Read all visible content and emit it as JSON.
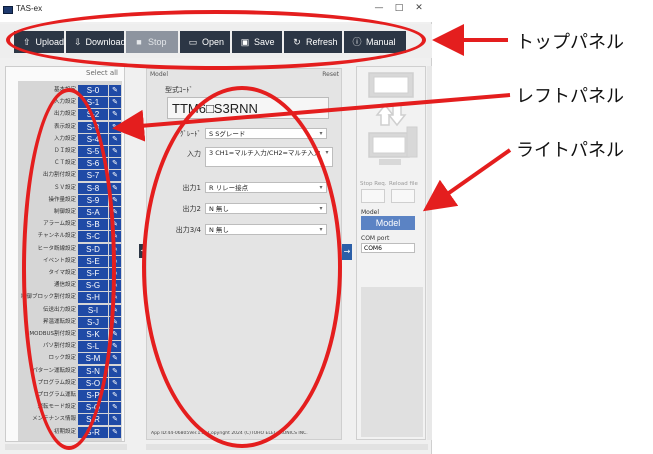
{
  "window": {
    "title": "TAS-ex",
    "controls": [
      "—",
      "□",
      "✕"
    ]
  },
  "toolbar": {
    "buttons": [
      {
        "label": "Upload",
        "icon": "upload-icon",
        "glyph": "⇧",
        "enabled": true
      },
      {
        "label": "Download",
        "icon": "download-icon",
        "glyph": "⇩",
        "enabled": true
      },
      {
        "label": "Stop",
        "icon": "stop-icon",
        "glyph": "■",
        "enabled": false
      },
      {
        "label": "Open",
        "icon": "folder-icon",
        "glyph": "▭",
        "enabled": true
      },
      {
        "label": "Save",
        "icon": "save-icon",
        "glyph": "▣",
        "enabled": true
      },
      {
        "label": "Refresh",
        "icon": "refresh-icon",
        "glyph": "↻",
        "enabled": true
      },
      {
        "label": "Manual",
        "icon": "info-icon",
        "glyph": "ⓘ",
        "enabled": true
      }
    ]
  },
  "left_panel": {
    "header": "Select all",
    "items": [
      {
        "label": "基本設定",
        "code": "S-0"
      },
      {
        "label": "入力設定",
        "code": "S-1"
      },
      {
        "label": "出力設定",
        "code": "S-2"
      },
      {
        "label": "表示設定",
        "code": "S-3"
      },
      {
        "label": "入力設定",
        "code": "S-4"
      },
      {
        "label": "ＤＩ設定",
        "code": "S-5"
      },
      {
        "label": "ＣＴ設定",
        "code": "S-6"
      },
      {
        "label": "出力割付設定",
        "code": "S-7"
      },
      {
        "label": "ＳＶ設定",
        "code": "S-8"
      },
      {
        "label": "操作量設定",
        "code": "S-9"
      },
      {
        "label": "制御設定",
        "code": "S-A"
      },
      {
        "label": "アラーム設定",
        "code": "S-B"
      },
      {
        "label": "チャンネル設定",
        "code": "S-C"
      },
      {
        "label": "ヒータ断線設定",
        "code": "S-D"
      },
      {
        "label": "イベント設定",
        "code": "S-E"
      },
      {
        "label": "タイマ設定",
        "code": "S-F"
      },
      {
        "label": "通信設定",
        "code": "S-G"
      },
      {
        "label": "制御ブロック割付設定",
        "code": "S-H"
      },
      {
        "label": "伝送出力設定",
        "code": "S-I"
      },
      {
        "label": "昇温運転設定",
        "code": "S-J"
      },
      {
        "label": "MODBUS割付設定",
        "code": "S-K"
      },
      {
        "label": "パソ割付設定",
        "code": "S-L"
      },
      {
        "label": "ロック設定",
        "code": "S-M"
      },
      {
        "label": "パターン運転設定",
        "code": "S-N"
      },
      {
        "label": "プログラム設定",
        "code": "S-O"
      },
      {
        "label": "プログラム運転",
        "code": "S-P"
      },
      {
        "label": "運転モード設定",
        "code": "S-Q"
      },
      {
        "label": "メンテナンス情報",
        "code": "S-R"
      },
      {
        "label": "初期設定",
        "code": "S-R"
      }
    ]
  },
  "center_panel": {
    "label": "Model",
    "right_label": "Reset",
    "model_caption": "型式ｺｰﾄﾞ",
    "model_code": "TTM6□S3RNN",
    "fields": [
      {
        "label": "ｸﾞﾚｰﾄﾞ",
        "value": "S  Sグレード"
      },
      {
        "label": "入力",
        "value": "3  CH1=マルチ入力/CH2=マルチ入力"
      },
      {
        "label": "出力1",
        "value": "R  リレー接点"
      },
      {
        "label": "出力2",
        "value": "N  無し"
      },
      {
        "label": "出力3/4",
        "value": "N  無し"
      }
    ],
    "status": "App ID:44-06805Ver.1.2) Copyright 2024 (C)TOHO ELECTRONICS INC."
  },
  "right_panel": {
    "stop_req": "Stop Req.",
    "reload_file": "Reload file",
    "model_label": "Model",
    "model_button": "Model",
    "com_label": "COM port",
    "com_value": "COM6"
  },
  "annotations": {
    "top_panel": "トップパネル",
    "left_panel": "レフトパネル",
    "right_panel": "ライトパネル",
    "color": "#e41e1e"
  }
}
